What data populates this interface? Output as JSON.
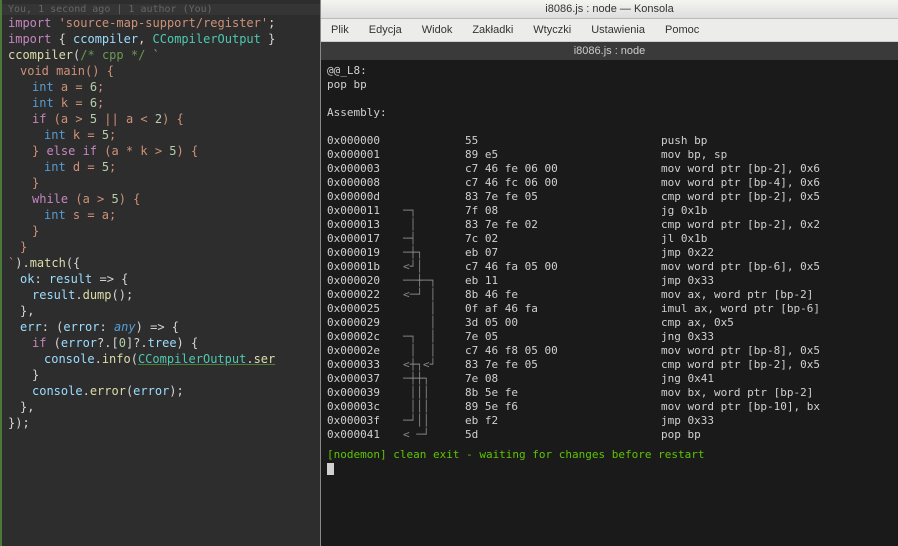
{
  "editor": {
    "blame": "You, 1 second ago | 1 author (You)",
    "lines": [
      {
        "cls": "code-line",
        "html": [
          {
            "t": "import ",
            "c": "kw"
          },
          {
            "t": "'source-map-support/register'",
            "c": "str"
          },
          {
            "t": ";",
            "c": "punct"
          }
        ]
      },
      {
        "cls": "code-line",
        "html": [
          {
            "t": "import ",
            "c": "kw"
          },
          {
            "t": "{ ",
            "c": "punct"
          },
          {
            "t": "ccompiler",
            "c": "var"
          },
          {
            "t": ", ",
            "c": "punct"
          },
          {
            "t": "CCompilerOutput",
            "c": "type"
          },
          {
            "t": " }",
            "c": "punct"
          }
        ]
      },
      {
        "cls": "code-line",
        "html": [
          {
            "t": "",
            "c": ""
          }
        ]
      },
      {
        "cls": "code-line",
        "html": [
          {
            "t": "ccompiler",
            "c": "func"
          },
          {
            "t": "(",
            "c": "punct"
          },
          {
            "t": "/* cpp */",
            "c": "comment"
          },
          {
            "t": " `",
            "c": "str"
          }
        ]
      },
      {
        "cls": "code-line indent1",
        "html": [
          {
            "t": "void main() {",
            "c": "str"
          }
        ]
      },
      {
        "cls": "code-line indent2",
        "html": [
          {
            "t": "int",
            "c": "kw2"
          },
          {
            "t": " a = ",
            "c": "str"
          },
          {
            "t": "6",
            "c": "num"
          },
          {
            "t": ";",
            "c": "str"
          }
        ]
      },
      {
        "cls": "code-line indent2",
        "html": [
          {
            "t": "int",
            "c": "kw2"
          },
          {
            "t": " k = ",
            "c": "str"
          },
          {
            "t": "6",
            "c": "num"
          },
          {
            "t": ";",
            "c": "str"
          }
        ]
      },
      {
        "cls": "code-line",
        "html": [
          {
            "t": "",
            "c": ""
          }
        ]
      },
      {
        "cls": "code-line indent2",
        "html": [
          {
            "t": "if",
            "c": "kw"
          },
          {
            "t": " (a > ",
            "c": "str"
          },
          {
            "t": "5",
            "c": "num"
          },
          {
            "t": " || a < ",
            "c": "str"
          },
          {
            "t": "2",
            "c": "num"
          },
          {
            "t": ") {",
            "c": "str"
          }
        ]
      },
      {
        "cls": "code-line indent3",
        "html": [
          {
            "t": "int",
            "c": "kw2"
          },
          {
            "t": " k = ",
            "c": "str"
          },
          {
            "t": "5",
            "c": "num"
          },
          {
            "t": ";",
            "c": "str"
          }
        ]
      },
      {
        "cls": "code-line indent2",
        "html": [
          {
            "t": "} ",
            "c": "str"
          },
          {
            "t": "else if",
            "c": "kw"
          },
          {
            "t": " (a * k > ",
            "c": "str"
          },
          {
            "t": "5",
            "c": "num"
          },
          {
            "t": ") {",
            "c": "str"
          }
        ]
      },
      {
        "cls": "code-line indent3",
        "html": [
          {
            "t": "int",
            "c": "kw2"
          },
          {
            "t": " d = ",
            "c": "str"
          },
          {
            "t": "5",
            "c": "num"
          },
          {
            "t": ";",
            "c": "str"
          }
        ]
      },
      {
        "cls": "code-line indent2",
        "html": [
          {
            "t": "}",
            "c": "str"
          }
        ]
      },
      {
        "cls": "code-line",
        "html": [
          {
            "t": "",
            "c": ""
          }
        ]
      },
      {
        "cls": "code-line indent2",
        "html": [
          {
            "t": "while",
            "c": "kw"
          },
          {
            "t": " (a > ",
            "c": "str"
          },
          {
            "t": "5",
            "c": "num"
          },
          {
            "t": ") {",
            "c": "str"
          }
        ]
      },
      {
        "cls": "code-line indent3",
        "html": [
          {
            "t": "int",
            "c": "kw2"
          },
          {
            "t": " s = a;",
            "c": "str"
          }
        ]
      },
      {
        "cls": "code-line indent2",
        "html": [
          {
            "t": "}",
            "c": "str"
          }
        ]
      },
      {
        "cls": "code-line indent1",
        "html": [
          {
            "t": "}",
            "c": "str"
          }
        ]
      },
      {
        "cls": "code-line",
        "html": [
          {
            "t": "`",
            "c": "str"
          },
          {
            "t": ").",
            "c": "punct"
          },
          {
            "t": "match",
            "c": "func"
          },
          {
            "t": "({",
            "c": "punct"
          }
        ]
      },
      {
        "cls": "code-line indent1",
        "html": [
          {
            "t": "ok",
            "c": "prop"
          },
          {
            "t": ": ",
            "c": "punct"
          },
          {
            "t": "result",
            "c": "var"
          },
          {
            "t": " => {",
            "c": "punct"
          }
        ]
      },
      {
        "cls": "code-line indent2",
        "html": [
          {
            "t": "result",
            "c": "var"
          },
          {
            "t": ".",
            "c": "punct"
          },
          {
            "t": "dump",
            "c": "func"
          },
          {
            "t": "();",
            "c": "punct"
          }
        ]
      },
      {
        "cls": "code-line indent1",
        "html": [
          {
            "t": "},",
            "c": "punct"
          }
        ]
      },
      {
        "cls": "code-line indent1",
        "html": [
          {
            "t": "err",
            "c": "prop"
          },
          {
            "t": ": (",
            "c": "punct"
          },
          {
            "t": "error",
            "c": "var"
          },
          {
            "t": ": ",
            "c": "punct"
          },
          {
            "t": "any",
            "c": "any"
          },
          {
            "t": ") => {",
            "c": "punct"
          }
        ]
      },
      {
        "cls": "code-line indent2",
        "html": [
          {
            "t": "if",
            "c": "kw"
          },
          {
            "t": " (",
            "c": "punct"
          },
          {
            "t": "error",
            "c": "var"
          },
          {
            "t": "?.[",
            "c": "punct"
          },
          {
            "t": "0",
            "c": "num"
          },
          {
            "t": "]?.",
            "c": "punct"
          },
          {
            "t": "tree",
            "c": "prop"
          },
          {
            "t": ") {",
            "c": "punct"
          }
        ]
      },
      {
        "cls": "code-line indent3",
        "html": [
          {
            "t": "console",
            "c": "var"
          },
          {
            "t": ".",
            "c": "punct"
          },
          {
            "t": "info",
            "c": "func"
          },
          {
            "t": "(",
            "c": "punct"
          },
          {
            "t": "CCompilerOutput",
            "c": "type underline"
          },
          {
            "t": ".",
            "c": "punct underline"
          },
          {
            "t": "ser",
            "c": "func underline"
          }
        ]
      },
      {
        "cls": "code-line indent2",
        "html": [
          {
            "t": "}",
            "c": "punct"
          }
        ]
      },
      {
        "cls": "code-line",
        "html": [
          {
            "t": "",
            "c": ""
          }
        ]
      },
      {
        "cls": "code-line indent2",
        "html": [
          {
            "t": "console",
            "c": "var"
          },
          {
            "t": ".",
            "c": "punct"
          },
          {
            "t": "error",
            "c": "func"
          },
          {
            "t": "(",
            "c": "punct"
          },
          {
            "t": "error",
            "c": "var"
          },
          {
            "t": ");",
            "c": "punct"
          }
        ]
      },
      {
        "cls": "code-line indent1",
        "html": [
          {
            "t": "},",
            "c": "punct"
          }
        ]
      },
      {
        "cls": "code-line",
        "html": [
          {
            "t": "});",
            "c": "punct"
          }
        ]
      }
    ]
  },
  "terminal": {
    "title": "i8086.js : node — Konsola",
    "menu": [
      "Plik",
      "Edycja",
      "Widok",
      "Zakładki",
      "Wtyczki",
      "Ustawienia",
      "Pomoc"
    ],
    "tab": "i8086.js : node",
    "header": [
      "@@_L8:",
      "pop bp",
      "",
      "Assembly:",
      ""
    ],
    "asm": [
      {
        "addr": "0x000000",
        "graph": "",
        "hex": "55",
        "mn": "push bp"
      },
      {
        "addr": "0x000001",
        "graph": "",
        "hex": "89 e5",
        "mn": "mov bp, sp"
      },
      {
        "addr": "0x000003",
        "graph": "",
        "hex": "c7 46 fe 06 00",
        "mn": "mov word ptr [bp-2], 0x6"
      },
      {
        "addr": "0x000008",
        "graph": "",
        "hex": "c7 46 fc 06 00",
        "mn": "mov word ptr [bp-4], 0x6"
      },
      {
        "addr": "0x00000d",
        "graph": "",
        "hex": "83 7e fe 05",
        "mn": "cmp word ptr [bp-2], 0x5"
      },
      {
        "addr": "0x000011",
        "graph": "─┐",
        "hex": "7f 08",
        "mn": "jg 0x1b"
      },
      {
        "addr": "0x000013",
        "graph": " │",
        "hex": "83 7e fe 02",
        "mn": "cmp word ptr [bp-2], 0x2"
      },
      {
        "addr": "0x000017",
        "graph": "─┤",
        "hex": "7c 02",
        "mn": "jl 0x1b"
      },
      {
        "addr": "0x000019",
        "graph": "─┼┐",
        "hex": "eb 07",
        "mn": "jmp 0x22"
      },
      {
        "addr": "0x00001b",
        "graph": "<┘│",
        "hex": "c7 46 fa 05 00",
        "mn": "mov word ptr [bp-6], 0x5"
      },
      {
        "addr": "0x000020",
        "graph": "──┼─┐",
        "hex": "eb 11",
        "mn": "jmp 0x33"
      },
      {
        "addr": "0x000022",
        "graph": "<─┘ │",
        "hex": "8b 46 fe",
        "mn": "mov ax, word ptr [bp-2]"
      },
      {
        "addr": "0x000025",
        "graph": "    │",
        "hex": "0f af 46 fa",
        "mn": "imul ax, word ptr [bp-6]"
      },
      {
        "addr": "0x000029",
        "graph": "    │",
        "hex": "3d 05 00",
        "mn": "cmp ax, 0x5"
      },
      {
        "addr": "0x00002c",
        "graph": "─┐  │",
        "hex": "7e 05",
        "mn": "jng 0x33"
      },
      {
        "addr": "0x00002e",
        "graph": " │  │",
        "hex": "c7 46 f8 05 00",
        "mn": "mov word ptr [bp-8], 0x5"
      },
      {
        "addr": "0x000033",
        "graph": "<┼┐<┘",
        "hex": "83 7e fe 05",
        "mn": "cmp word ptr [bp-2], 0x5"
      },
      {
        "addr": "0x000037",
        "graph": "─┼┼┐",
        "hex": "7e 08",
        "mn": "jng 0x41"
      },
      {
        "addr": "0x000039",
        "graph": " │││",
        "hex": "8b 5e fe",
        "mn": "mov bx, word ptr [bp-2]"
      },
      {
        "addr": "0x00003c",
        "graph": " │││",
        "hex": "89 5e f6",
        "mn": "mov word ptr [bp-10], bx"
      },
      {
        "addr": "0x00003f",
        "graph": "─┘││",
        "hex": "eb f2",
        "mn": "jmp 0x33"
      },
      {
        "addr": "0x000041",
        "graph": "< ─┘",
        "hex": "5d",
        "mn": "pop bp"
      }
    ],
    "footer": "[nodemon] clean exit - waiting for changes before restart"
  }
}
